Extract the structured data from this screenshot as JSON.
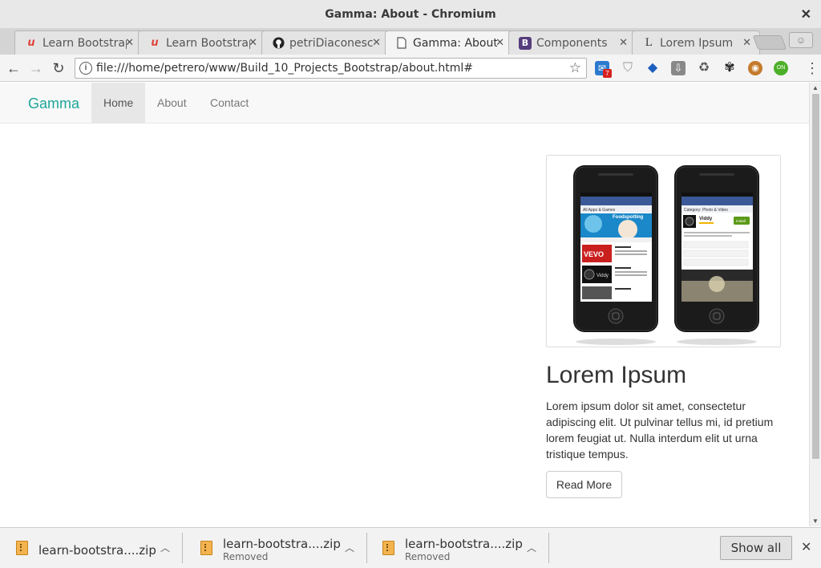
{
  "window": {
    "title": "Gamma: About - Chromium"
  },
  "tabs": [
    {
      "label": "Learn Bootstrap",
      "icon": "udemy-icon",
      "active": false
    },
    {
      "label": "Learn Bootstrap",
      "icon": "udemy-icon",
      "active": false
    },
    {
      "label": "petriDiaconescu",
      "icon": "github-icon",
      "active": false
    },
    {
      "label": "Gamma: About",
      "icon": "page-icon",
      "active": true
    },
    {
      "label": "Components",
      "icon": "bootstrap-icon",
      "active": false
    },
    {
      "label": "Lorem Ipsum",
      "icon": "lorem-icon",
      "active": false
    }
  ],
  "toolbar": {
    "url": "file:///home/petrero/www/Build_10_Projects_Bootstrap/about.html#",
    "badge": "7"
  },
  "page": {
    "brand": "Gamma",
    "nav": [
      {
        "label": "Home",
        "active": true
      },
      {
        "label": "About",
        "active": false
      },
      {
        "label": "Contact",
        "active": false
      }
    ],
    "heading": "Lorem Ipsum",
    "body": "Lorem ipsum dolor sit amet, consectetur adipiscing elit. Ut pulvinar tellus mi, id pretium lorem feugiat ut. Nulla interdum elit ut urna tristique tempus.",
    "button": "Read More",
    "phone_screens": {
      "left": {
        "header": "All Apps & Games",
        "banner": "Foodspotting",
        "items": [
          "VEVO",
          "Viddy"
        ]
      },
      "right": {
        "header": "Category: Photo & Video",
        "app": "Viddy",
        "action": "Install"
      }
    }
  },
  "downloads": [
    {
      "name": "learn-bootstra....zip",
      "status": ""
    },
    {
      "name": "learn-bootstra....zip",
      "status": "Removed"
    },
    {
      "name": "learn-bootstra....zip",
      "status": "Removed"
    }
  ],
  "shelf": {
    "show_all": "Show all"
  },
  "colors": {
    "brand": "#1ea69a",
    "udemy": "#e0443c",
    "bootstrap": "#563d7c"
  }
}
